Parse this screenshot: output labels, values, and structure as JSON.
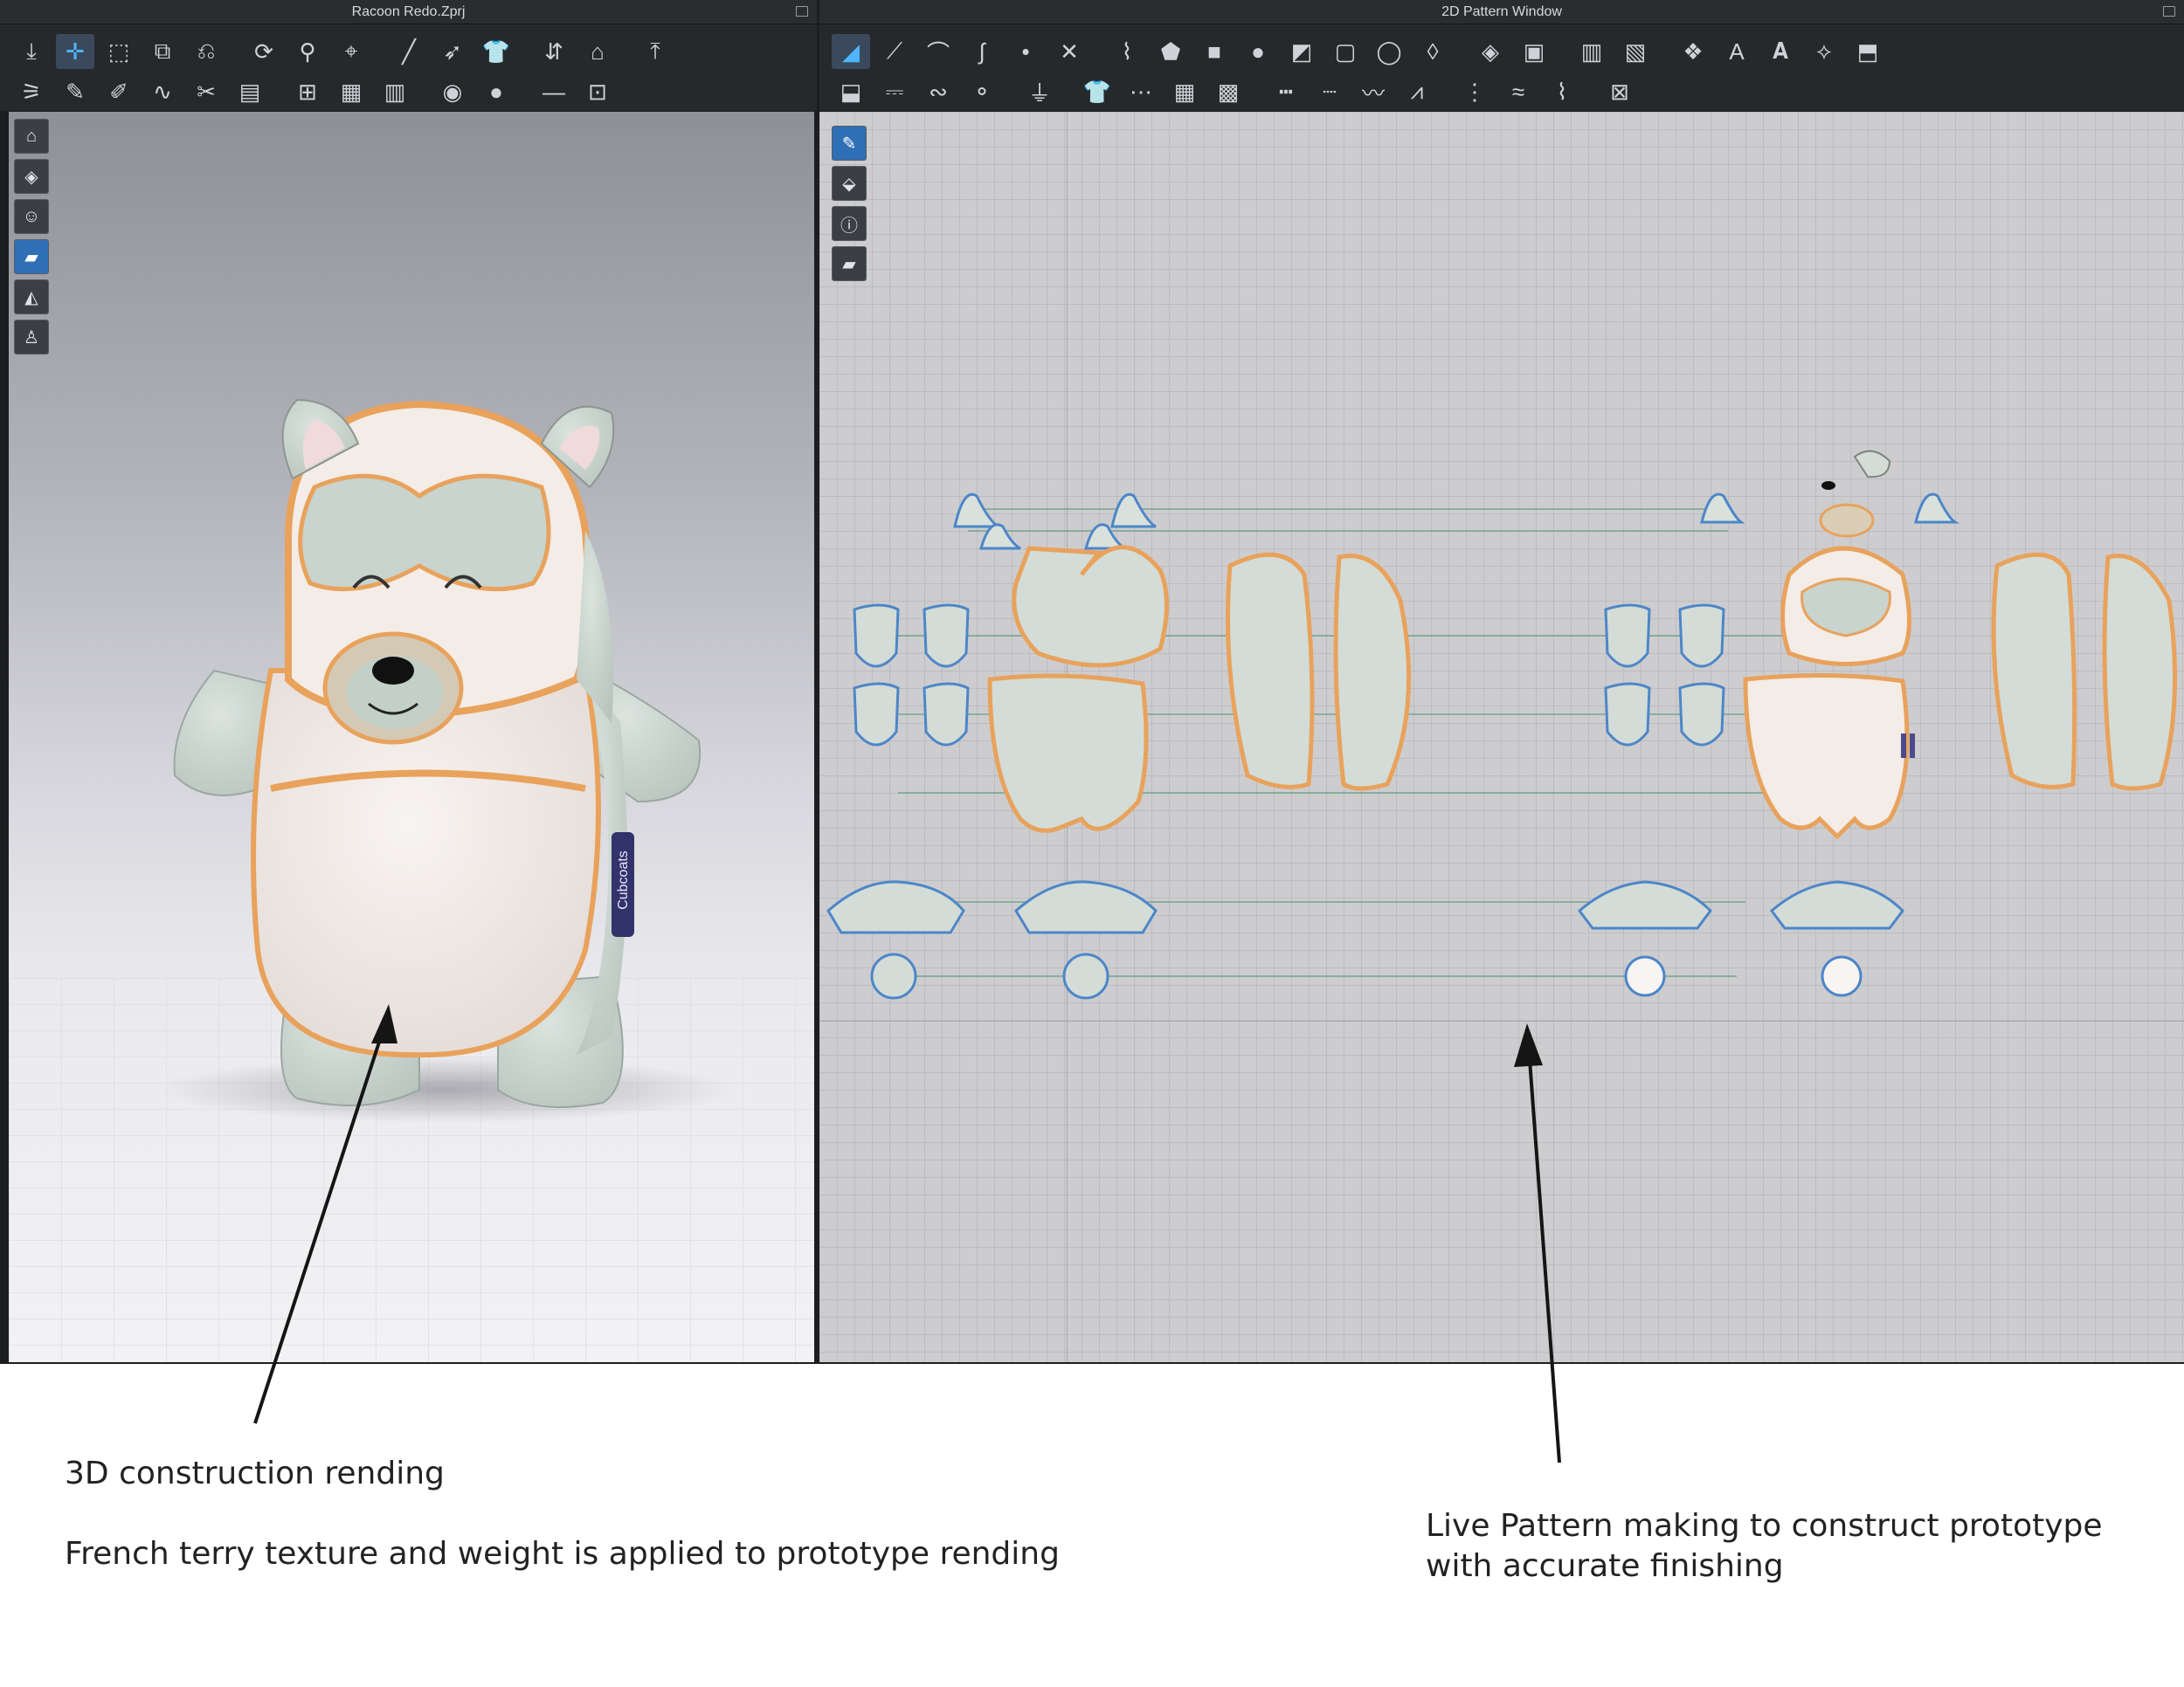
{
  "left_window": {
    "title": "Racoon Redo.Zprj",
    "toolbar_rows": [
      [
        "arrow-down-icon",
        "move-icon",
        "box-select-icon",
        "transform-icon",
        "fold-icon",
        "sep",
        "simulate-icon",
        "pin-icon",
        "tack-icon",
        "sep",
        "line-icon",
        "needle-icon",
        "shirt-icon",
        "sep",
        "arrange-icon",
        "avatar-icon",
        "sep",
        "arrow-up-icon"
      ],
      [
        "walk-icon",
        "pen-icon",
        "brush-icon",
        "wave-icon",
        "scissors-icon",
        "stack-icon",
        "sep",
        "garment-icon",
        "grid-icon",
        "shirt-pattern-icon",
        "sep",
        "button-icon",
        "dot-icon",
        "sep",
        "line-tool-icon",
        "lock-icon"
      ]
    ],
    "side_tools": [
      "garment-view-icon",
      "texture-view-icon",
      "avatar-view-icon",
      "fabric-view-icon",
      "shade-view-icon",
      "figure-view-icon"
    ],
    "active_side_tool": 3,
    "model_label": "Cubcoats"
  },
  "right_window": {
    "title": "2D Pattern Window",
    "toolbar_rows": [
      [
        "select-pattern-icon",
        "edit-point-icon",
        "curve-icon",
        "curve-point-icon",
        "add-point-icon",
        "cut-icon",
        "sep",
        "internal-line-icon",
        "polygon-icon",
        "rectangle-icon",
        "circle-icon",
        "trace-icon",
        "box-icon",
        "ellipse-icon",
        "dart-icon",
        "sep",
        "shape-icon",
        "block-icon",
        "sep",
        "pleat-icon",
        "layer-icon",
        "sep",
        "fabric-icon",
        "text-a-icon",
        "text-a-large-icon",
        "measure-icon",
        "tag-icon"
      ],
      [
        "seam-icon",
        "segment-icon",
        "free-seam-icon",
        "tack-point-icon",
        "sep",
        "iron-icon",
        "sep",
        "shirt-icon",
        "stitch-icon",
        "grid-icon",
        "pattern-grid-icon",
        "sep",
        "dash-line-icon",
        "dotted-line-icon",
        "wavy-line-icon",
        "zigzag-icon",
        "sep",
        "topstitch-icon",
        "piping-icon",
        "elastic-icon",
        "sep",
        "trim-icon"
      ]
    ],
    "side_tools": [
      "pen-view-icon",
      "shirt-view-icon",
      "info-view-icon",
      "fabric-view-icon"
    ],
    "active_side_tool": 0
  },
  "captions": {
    "left_title": "3D construction rending",
    "left_body": "French terry texture and weight is applied to prototype rending",
    "right_line1": "Live Pattern making to construct prototype",
    "right_line2": "with accurate finishing"
  },
  "colors": {
    "accent": "#4fb5ff",
    "fabric": "#d3dcd6",
    "seam_orange": "#e8a25c",
    "outline_blue": "#4d86c8",
    "belly": "#f3ece7"
  }
}
